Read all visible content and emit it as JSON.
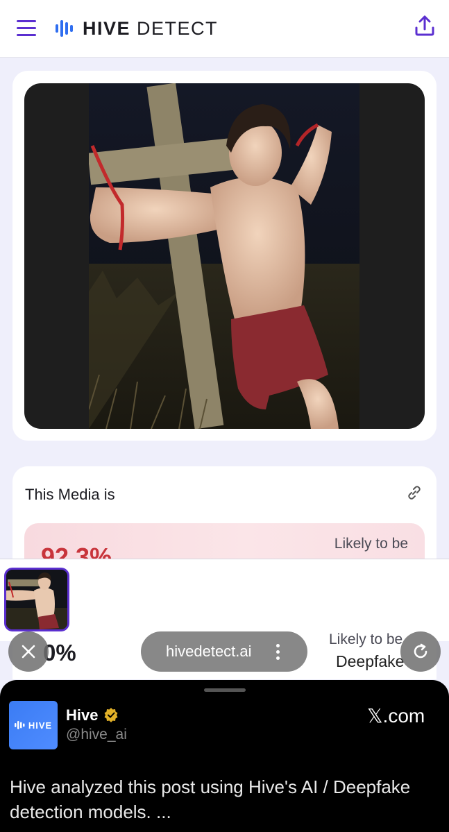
{
  "header": {
    "logo_bold": "HIVE",
    "logo_light": " DETECT",
    "menu_icon": "hamburger-menu-icon",
    "share_icon": "upload-share-icon",
    "brand_color": "#5b2fd0"
  },
  "image_card": {
    "photo_alt": "Uploaded media being analyzed"
  },
  "result": {
    "title": "This Media is",
    "link_icon": "link-icon",
    "score": "92.3%",
    "likely_label": "Likely to be",
    "lower_score": "0%",
    "lower_likely": "Likely to be",
    "lower_label": "Deepfake",
    "score_color": "#c8343b"
  },
  "browser": {
    "url": "hivedetect.ai",
    "close_icon": "close-icon",
    "more_icon": "more-vertical-icon",
    "reload_icon": "reload-icon"
  },
  "tweet": {
    "avatar_text": "HIVE",
    "author": "Hive",
    "handle": "@hive_ai",
    "source": "𝕏.com",
    "text": "Hive analyzed this post using Hive's AI / Deepfake detection models. ..."
  }
}
